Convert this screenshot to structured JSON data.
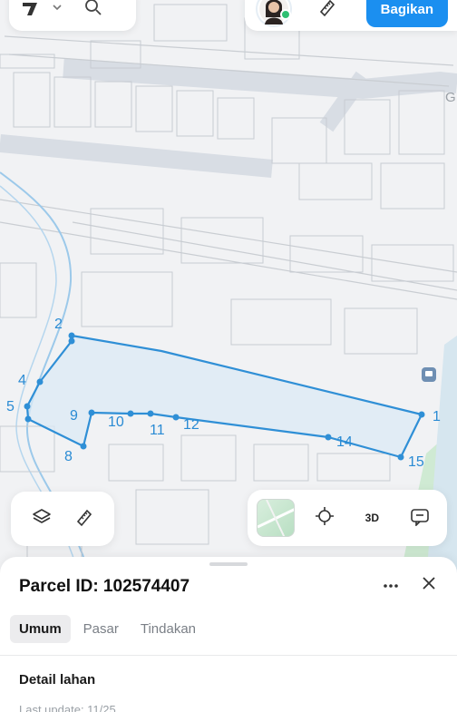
{
  "header": {
    "share_label": "Bagikan",
    "map_edge_label": "G"
  },
  "parcel": {
    "title": "Parcel ID: 102574407",
    "point_labels": [
      "2",
      "4",
      "5",
      "8",
      "9",
      "10",
      "11",
      "12",
      "14",
      "15",
      "1"
    ]
  },
  "tabs": [
    {
      "label": "Umum",
      "active": true
    },
    {
      "label": "Pasar",
      "active": false
    },
    {
      "label": "Tindakan",
      "active": false
    }
  ],
  "details": {
    "section_title": "Detail lahan",
    "last_update": "Last update: 11/25"
  },
  "map_controls": {
    "view_3d_label": "3D"
  },
  "colors": {
    "accent": "#1b8ff0",
    "parcel_stroke": "#2f8fd6",
    "online": "#2fbf71"
  },
  "icons": [
    "logo-icon",
    "chevron-down-icon",
    "search-icon",
    "ruler-icon",
    "layers-icon",
    "locate-icon",
    "feedback-icon",
    "more-icon",
    "close-icon"
  ]
}
